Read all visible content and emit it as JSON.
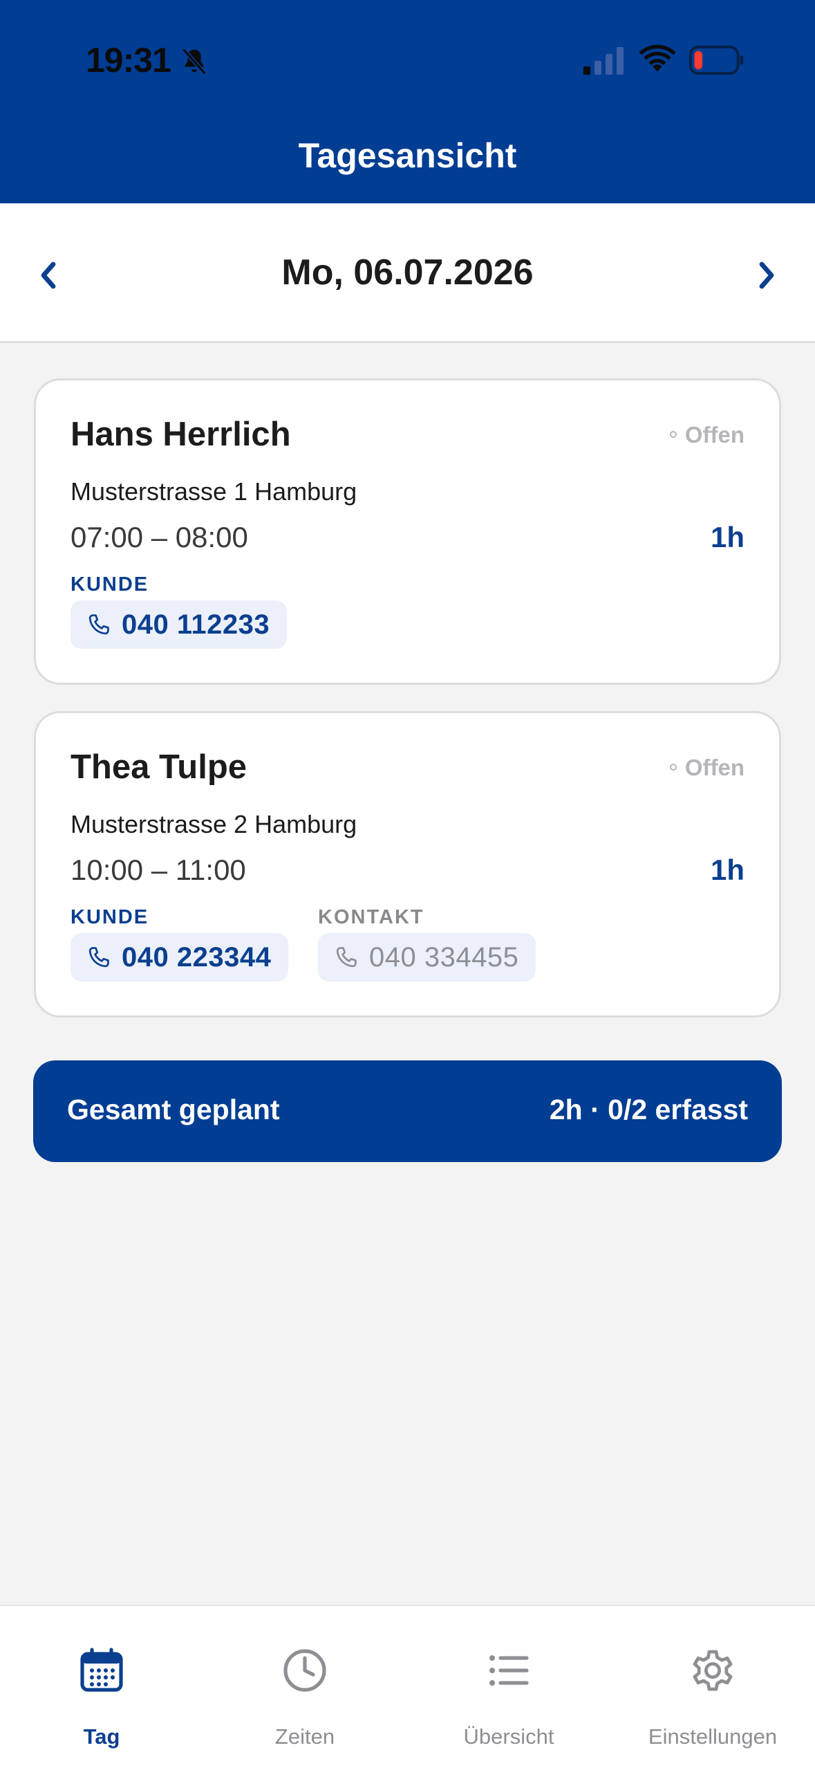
{
  "status_bar": {
    "time": "19:31"
  },
  "header": {
    "title": "Tagesansicht"
  },
  "date_nav": {
    "date": "Mo, 06.07.2026"
  },
  "appointments": [
    {
      "name": "Hans Herrlich",
      "status": "Offen",
      "address": "Musterstrasse 1 Hamburg",
      "time": "07:00 – 08:00",
      "duration": "1h",
      "phones": [
        {
          "label": "KUNDE",
          "number": "040 112233"
        }
      ]
    },
    {
      "name": "Thea Tulpe",
      "status": "Offen",
      "address": "Musterstrasse 2 Hamburg",
      "time": "10:00 – 11:00",
      "duration": "1h",
      "phones": [
        {
          "label": "KUNDE",
          "number": "040 223344"
        },
        {
          "label": "KONTAKT",
          "number": "040 334455"
        }
      ]
    }
  ],
  "summary": {
    "label": "Gesamt geplant",
    "value": "2h · 0/2 erfasst"
  },
  "tabbar": {
    "tabs": [
      {
        "label": "Tag",
        "icon": "calendar-icon",
        "active": true
      },
      {
        "label": "Zeiten",
        "icon": "clock-icon",
        "active": false
      },
      {
        "label": "Übersicht",
        "icon": "list-icon",
        "active": false
      },
      {
        "label": "Einstellungen",
        "icon": "gear-icon",
        "active": false
      }
    ]
  },
  "colors": {
    "brand": "#003d93",
    "accent_text": "#0b3f8f",
    "background": "#f3f3f4",
    "chip": "#ebf0fa",
    "muted": "#8e8e93"
  }
}
